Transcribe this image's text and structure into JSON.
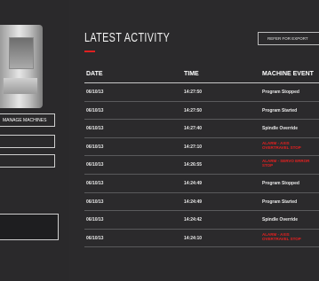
{
  "sidebar": {
    "fields": [
      "MANAGE MACHINES",
      "",
      ""
    ],
    "button_label": ""
  },
  "header": {
    "title": "LATEST ACTIVITY",
    "export_label": "REFER FOR EXPORT"
  },
  "table": {
    "columns": [
      "DATE",
      "TIME",
      "MACHINE EVENT"
    ],
    "rows": [
      {
        "date": "06/10/13",
        "time": "14:27:50",
        "event": "Program Stopped",
        "alarm": false
      },
      {
        "date": "06/10/13",
        "time": "14:27:50",
        "event": "Program Started",
        "alarm": false
      },
      {
        "date": "06/10/13",
        "time": "14:27:40",
        "event": "Spindle Override",
        "alarm": false
      },
      {
        "date": "06/10/13",
        "time": "14:27:10",
        "event": "ALARM - AXIS OVERTRAVEL STOP",
        "alarm": true
      },
      {
        "date": "06/10/13",
        "time": "14:26:55",
        "event": "ALARM - SERVO ERROR STOP",
        "alarm": true
      },
      {
        "date": "06/10/13",
        "time": "14:24:49",
        "event": "Program Stopped",
        "alarm": false
      },
      {
        "date": "06/10/13",
        "time": "14:24:49",
        "event": "Program Started",
        "alarm": false
      },
      {
        "date": "06/10/13",
        "time": "14:24:42",
        "event": "Spindle Override",
        "alarm": false
      },
      {
        "date": "06/10/13",
        "time": "14:24:10",
        "event": "ALARM - AXIS OVERTRAVEL STOP",
        "alarm": true
      }
    ]
  },
  "colors": {
    "background": "#2b2a2c",
    "accent": "#e02020",
    "alarm_text": "#e52020"
  }
}
